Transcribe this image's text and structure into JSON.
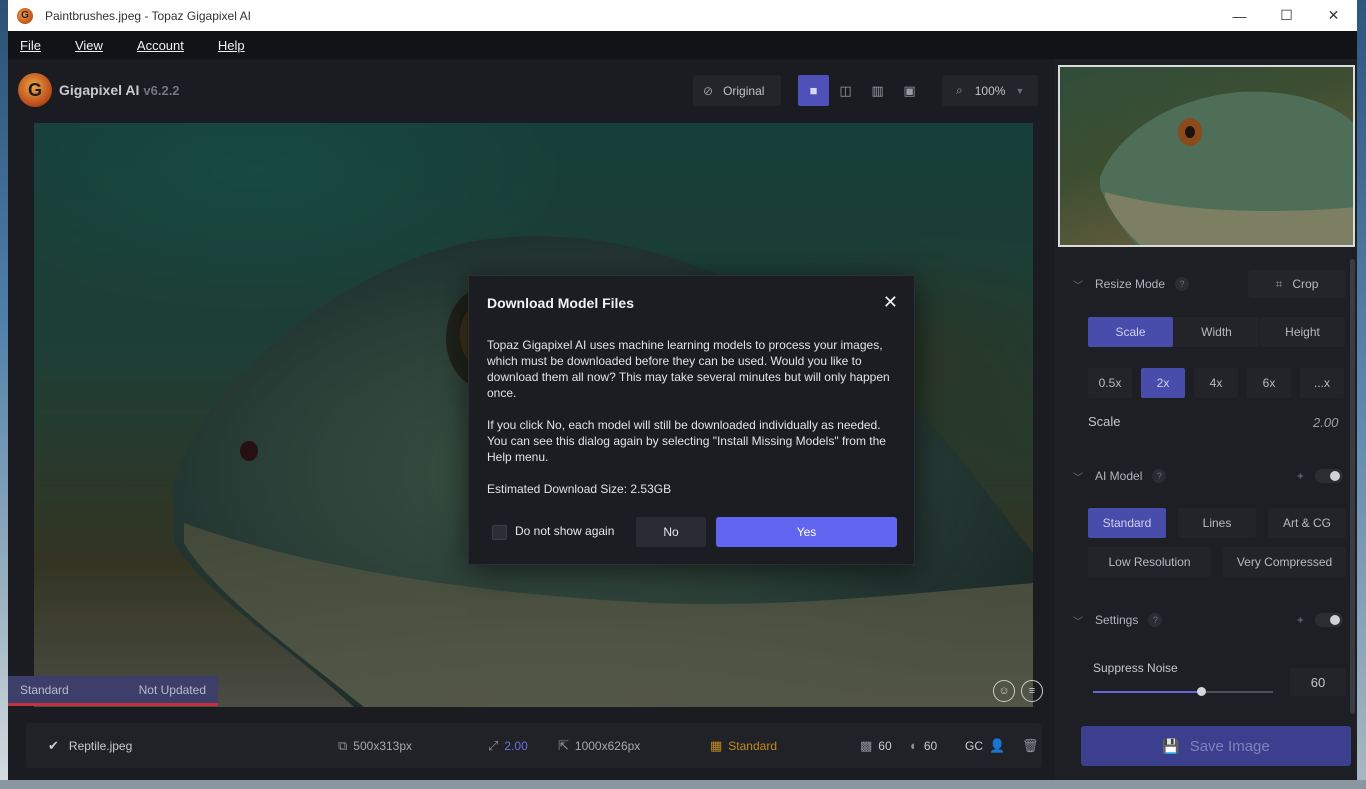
{
  "window": {
    "title": "Paintbrushes.jpeg - Topaz Gigapixel AI",
    "controls": {
      "minimize": "—",
      "maximize": "☐",
      "close": "✕"
    }
  },
  "menu": [
    "File",
    "View",
    "Account",
    "Help"
  ],
  "brand": {
    "name": "Gigapixel AI",
    "version": "v6.2.2",
    "logo_letter": "G"
  },
  "toolbar": {
    "original_label": "Original",
    "zoom_label": "100%",
    "views": [
      "single-view-icon",
      "split-view-icon",
      "side-by-side-icon",
      "quad-view-icon"
    ],
    "active_view": 0
  },
  "image_status": {
    "model": "Standard",
    "state": "Not Updated"
  },
  "bottom_bar": {
    "filename": "Reptile.jpeg",
    "input_size": "500x313px",
    "scale": "2.00",
    "output_size": "1000x626px",
    "model": "Standard",
    "noise": "60",
    "blur": "60",
    "gc": "GC"
  },
  "side": {
    "resize_mode": {
      "label": "Resize Mode",
      "help": "?",
      "crop_label": "Crop",
      "modes": [
        "Scale",
        "Width",
        "Height"
      ],
      "active_mode": 0,
      "scales": [
        "0.5x",
        "2x",
        "4x",
        "6x",
        "...x"
      ],
      "active_scale": 1,
      "scale_label": "Scale",
      "scale_value": "2.00"
    },
    "ai_model": {
      "label": "AI Model",
      "help": "?",
      "models_row1": [
        "Standard",
        "Lines",
        "Art & CG"
      ],
      "models_row2": [
        "Low Resolution",
        "Very Compressed"
      ],
      "active_model": 0
    },
    "settings": {
      "label": "Settings",
      "help": "?",
      "suppress_noise_label": "Suppress Noise",
      "suppress_noise_value": "60",
      "suppress_noise_fraction": 0.6
    },
    "save_label": "Save Image"
  },
  "dialog": {
    "title": "Download Model Files",
    "close": "✕",
    "paragraph1": "Topaz Gigapixel AI uses machine learning models to process your images, which must be downloaded before they can be used. Would you like to download them all now? This may take several minutes but will only happen once.",
    "paragraph2": "If you click No, each model will still be downloaded individually as needed. You can see this dialog again by selecting \"Install Missing Models\" from the Help menu.",
    "size_line": "Estimated Download Size: 2.53GB",
    "checkbox_label": "Do not show again",
    "no_label": "No",
    "yes_label": "Yes"
  },
  "colors": {
    "accent": "#6265f0",
    "active_segment": "#484caa",
    "warning_text": "#c48a1d",
    "status_bar_red": "#c7313b"
  }
}
